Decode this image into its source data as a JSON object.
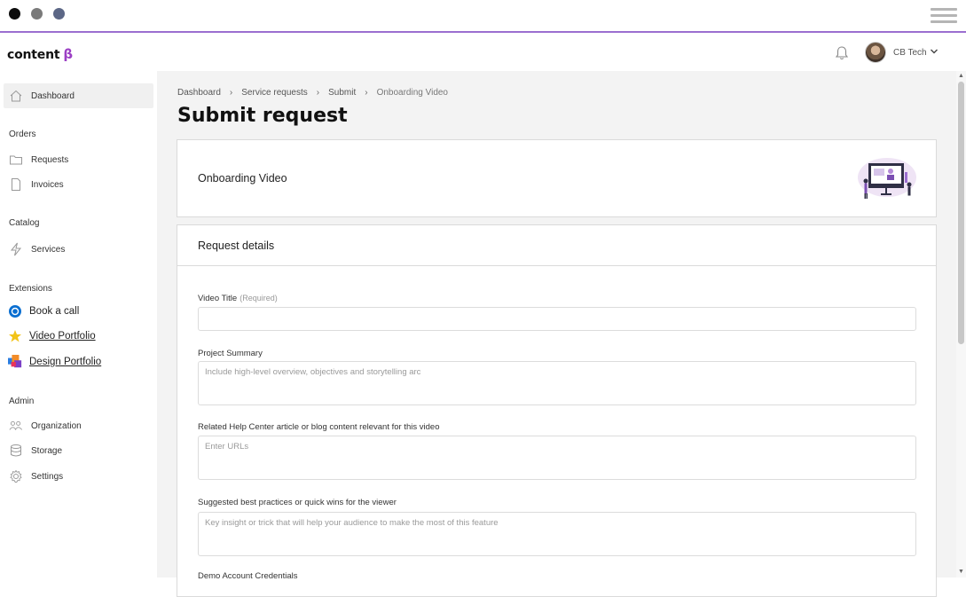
{
  "window": {
    "controls": [
      "close-dot",
      "minimize-dot",
      "maximize-dot"
    ],
    "menu_icon": "hamburger-icon"
  },
  "brand": {
    "logo_text": "content",
    "logo_beta": "β",
    "accent": "#9b3fc4"
  },
  "topbar": {
    "notification_icon": "bell-icon",
    "user_name": "CB Tech",
    "user_menu_icon": "chevron-down-icon"
  },
  "sidebar": {
    "dashboard": "Dashboard",
    "sections": {
      "orders": "Orders",
      "catalog": "Catalog",
      "extensions": "Extensions",
      "admin": "Admin"
    },
    "orders": [
      {
        "label": "Requests",
        "icon": "folder-icon"
      },
      {
        "label": "Invoices",
        "icon": "document-icon"
      }
    ],
    "catalog": [
      {
        "label": "Services",
        "icon": "bolt-icon"
      }
    ],
    "extensions": [
      {
        "label": "Book a call",
        "icon": "calendar-circle-icon"
      },
      {
        "label": "Video Portfolio",
        "icon": "star-icon"
      },
      {
        "label": "Design Portfolio",
        "icon": "color-blocks-icon"
      }
    ],
    "admin": [
      {
        "label": "Organization",
        "icon": "people-icon"
      },
      {
        "label": "Storage",
        "icon": "database-icon"
      },
      {
        "label": "Settings",
        "icon": "gear-icon"
      }
    ]
  },
  "breadcrumb": [
    "Dashboard",
    "Service requests",
    "Submit",
    "Onboarding Video"
  ],
  "page_title": "Submit request",
  "service": {
    "name": "Onboarding Video",
    "illustration": "video-presentation-illustration"
  },
  "form": {
    "title": "Request details",
    "fields": [
      {
        "label": "Video Title",
        "required_note": "(Required)",
        "value": "",
        "placeholder": ""
      },
      {
        "label": "Project Summary",
        "placeholder": "Include high-level overview, objectives and storytelling arc"
      },
      {
        "label": "Related Help Center article or blog content relevant for this video",
        "placeholder": "Enter URLs"
      },
      {
        "label": "Suggested best practices or quick wins for the viewer",
        "placeholder": "Key insight or trick that will help your audience to make the most of this feature"
      },
      {
        "label": "Demo Account Credentials"
      }
    ]
  }
}
